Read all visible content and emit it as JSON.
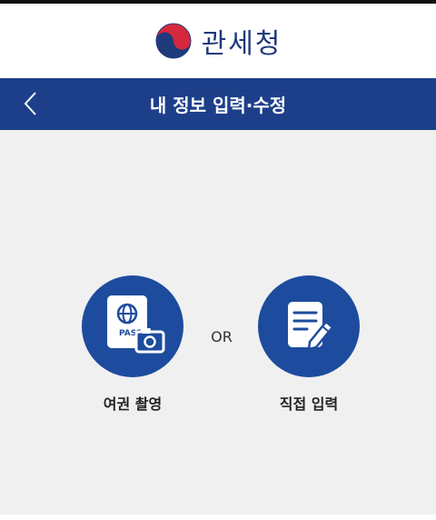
{
  "header": {
    "brand_name": "관세청",
    "logo_icon": "taegeuk-logo-icon"
  },
  "title_bar": {
    "back_icon": "chevron-left-icon",
    "title": "내 정보 입력·수정"
  },
  "options": {
    "passport": {
      "icon": "passport-camera-icon",
      "badge_text": "PASS",
      "label": "여권 촬영"
    },
    "divider": "OR",
    "manual": {
      "icon": "document-edit-icon",
      "label": "직접 입력"
    }
  },
  "colors": {
    "title_bar": "#1d3f8a",
    "option_circle": "#1d4c9e",
    "brand_text": "#1f3a7a",
    "content_bg": "#f0f0f0"
  }
}
